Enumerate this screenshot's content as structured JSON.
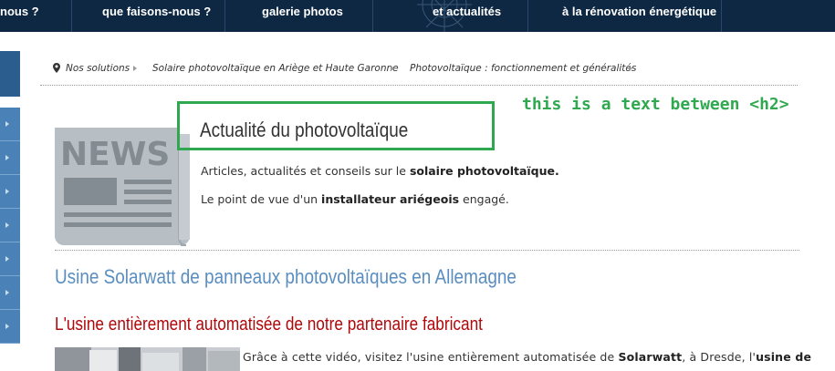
{
  "nav": {
    "items": [
      {
        "label": "nous ?"
      },
      {
        "label": "que faisons-nous ?"
      },
      {
        "label": "galerie photos"
      },
      {
        "label": "et actualités"
      },
      {
        "label": "à la rénovation énergétique"
      }
    ]
  },
  "breadcrumb": [
    "Nos solutions",
    "Solaire photovoltaïque en Ariège et Haute Garonne",
    "Photovoltaïque : fonctionnement et généralités"
  ],
  "news_icon_text": "NEWS",
  "heading": "Actualité du photovoltaïque",
  "annotation": "this is a text between <h2>",
  "intro": {
    "line1_pre": "Articles, actualités et conseils sur le ",
    "line1_bold": "solaire photovoltaïque.",
    "line2_pre": "Le point de vue d'un ",
    "line2_bold": "installateur ariégeois",
    "line2_post": " engagé."
  },
  "article": {
    "title": "Usine Solarwatt de panneaux photovoltaïques en Allemagne",
    "subtitle": "L'usine entièrement automatisée de notre partenaire fabricant",
    "text_pre": "Grâce à cette vidéo, visitez l'usine entièrement automatisée de ",
    "text_bold1": "Solarwatt",
    "text_mid": ", à Dresde, l'",
    "text_bold2": "usine de"
  },
  "colors": {
    "nav_bg": "#0e2844",
    "sidebar": "#4a82b7",
    "link_blue": "#5a8ec0",
    "red": "#b0070a",
    "annotation_green": "#2fa84f"
  }
}
